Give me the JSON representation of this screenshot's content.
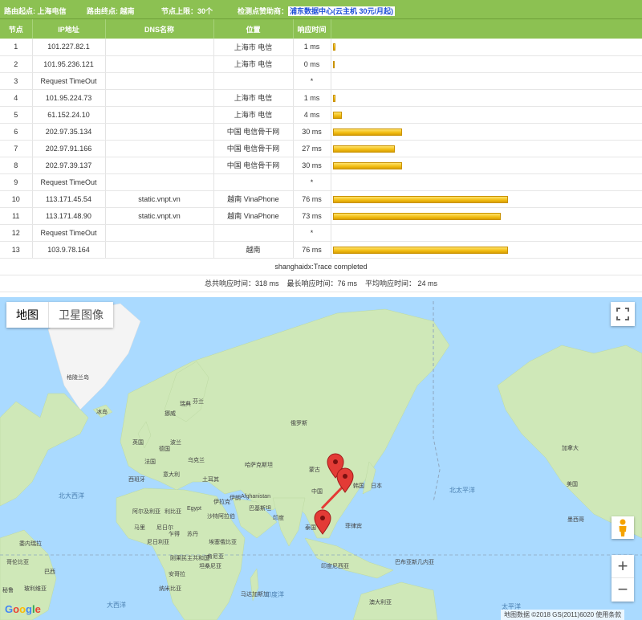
{
  "header": {
    "origin": "路由起点: 上海电信",
    "destination": "路由终点: 越南",
    "hop_limit": "节点上限：30个",
    "sponsor_prefix": "检测点赞助商：",
    "sponsor_link": "浦东数据中心",
    "sponsor_offer": "(云主机 30元/月起)"
  },
  "table": {
    "columns": [
      "节点",
      "IP地址",
      "DNS名称",
      "位置",
      "响应时间",
      ""
    ],
    "rows": [
      {
        "hop": "1",
        "ip": "101.227.82.1",
        "dns": "",
        "location": "上海市 电信",
        "time": "1 ms",
        "ms": 1
      },
      {
        "hop": "2",
        "ip": "101.95.236.121",
        "dns": "",
        "location": "上海市 电信",
        "time": "0 ms",
        "ms": 0
      },
      {
        "hop": "3",
        "ip": "Request TimeOut",
        "dns": "",
        "location": "",
        "time": "*",
        "ms": null
      },
      {
        "hop": "4",
        "ip": "101.95.224.73",
        "dns": "",
        "location": "上海市 电信",
        "time": "1 ms",
        "ms": 1
      },
      {
        "hop": "5",
        "ip": "61.152.24.10",
        "dns": "",
        "location": "上海市 电信",
        "time": "4 ms",
        "ms": 4
      },
      {
        "hop": "6",
        "ip": "202.97.35.134",
        "dns": "",
        "location": "中国 电信骨干网",
        "time": "30 ms",
        "ms": 30
      },
      {
        "hop": "7",
        "ip": "202.97.91.166",
        "dns": "",
        "location": "中国 电信骨干网",
        "time": "27 ms",
        "ms": 27
      },
      {
        "hop": "8",
        "ip": "202.97.39.137",
        "dns": "",
        "location": "中国 电信骨干网",
        "time": "30 ms",
        "ms": 30
      },
      {
        "hop": "9",
        "ip": "Request TimeOut",
        "dns": "",
        "location": "",
        "time": "*",
        "ms": null
      },
      {
        "hop": "10",
        "ip": "113.171.45.54",
        "dns": "static.vnpt.vn",
        "location": "越南 VinaPhone",
        "time": "76 ms",
        "ms": 76
      },
      {
        "hop": "11",
        "ip": "113.171.48.90",
        "dns": "static.vnpt.vn",
        "location": "越南 VinaPhone",
        "time": "73 ms",
        "ms": 73
      },
      {
        "hop": "12",
        "ip": "Request TimeOut",
        "dns": "",
        "location": "",
        "time": "*",
        "ms": null
      },
      {
        "hop": "13",
        "ip": "103.9.78.164",
        "dns": "",
        "location": "越南",
        "time": "76 ms",
        "ms": 76
      }
    ],
    "status": "shanghaidx:Trace completed",
    "summary": "总共响应时间：318 ms    最长响应时间：76 ms    平均响应时间： 24 ms"
  },
  "map": {
    "map_button": "地图",
    "satellite_button": "卫星图像",
    "zoom_in": "+",
    "zoom_out": "−",
    "google_logo": [
      "G",
      "o",
      "o",
      "g",
      "l",
      "e"
    ],
    "footer": "地图数据 ©2018 GS(2011)6020   使用条款",
    "labels": {
      "greenland": "格陵兰岛",
      "iceland": "冰岛",
      "norway": "挪威",
      "finland": "芬兰",
      "sweden": "瑞典",
      "russia": "俄罗斯",
      "uk": "英国",
      "germany": "德国",
      "poland": "波兰",
      "ukraine": "乌克兰",
      "france": "法国",
      "spain": "西班牙",
      "italy": "意大利",
      "turkey": "土耳其",
      "kazakhstan": "哈萨克斯坦",
      "mongolia": "蒙古",
      "china": "中国",
      "japan": "日本",
      "korea": "韩国",
      "algeria": "阿尔及利亚",
      "libya": "利比亚",
      "egypt": "Egypt",
      "iran": "伊朗",
      "iraq": "伊拉克",
      "afghanistan": "Afghanistan",
      "pakistan": "巴基斯坦",
      "saudi": "沙特阿拉伯",
      "india": "印度",
      "thailand": "泰国",
      "philippines": "菲律宾",
      "mali": "马里",
      "niger": "尼日尔",
      "chad": "乍得",
      "sudan": "苏丹",
      "nigeria": "尼日利亚",
      "ethiopia": "埃塞俄比亚",
      "drc": "刚果民主共和国",
      "kenya": "肯尼亚",
      "tanzania": "坦桑尼亚",
      "angola": "安哥拉",
      "namibia": "纳米比亚",
      "madagascar": "马达加斯加",
      "indonesia": "印度尼西亚",
      "papua": "巴布亚新几内亚",
      "australia": "澳大利亚",
      "canada": "加拿大",
      "usa": "美国",
      "mexico": "墨西哥",
      "venezuela": "委内瑞拉",
      "colombia": "哥伦比亚",
      "peru": "秘鲁",
      "brazil": "巴西",
      "bolivia": "玻利维亚",
      "n_atlantic": "北大西洋",
      "n_pacific": "北太平洋",
      "atlantic": "大西洋",
      "indian": "印度洋",
      "pacific": "太平洋"
    }
  }
}
